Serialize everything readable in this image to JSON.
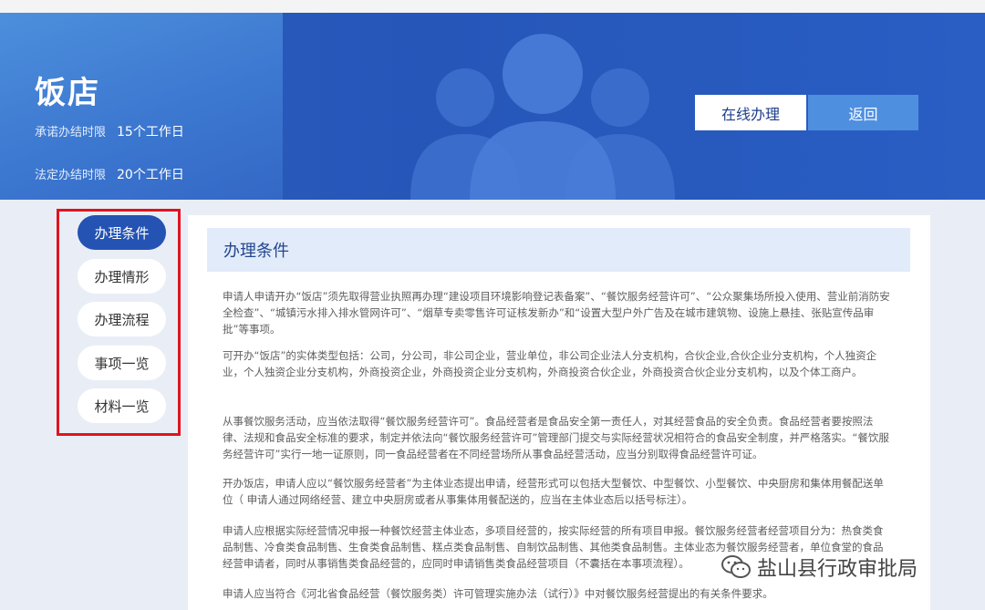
{
  "header": {
    "title": "饭店",
    "promise_label": "承诺办结时限",
    "promise_value": "15个工作日",
    "legal_label": "法定办结时限",
    "legal_value": "20个工作日",
    "online_button": "在线办理",
    "back_button": "返回"
  },
  "sidebar": {
    "items": [
      {
        "label": "办理条件",
        "active": true
      },
      {
        "label": "办理情形",
        "active": false
      },
      {
        "label": "办理流程",
        "active": false
      },
      {
        "label": "事项一览",
        "active": false
      },
      {
        "label": "材料一览",
        "active": false
      }
    ]
  },
  "content": {
    "heading": "办理条件",
    "paragraphs": [
      "申请人申请开办“饭店”须先取得营业执照再办理“建设项目环境影响登记表备案”、“餐饮服务经营许可”、“公众聚集场所投入使用、营业前消防安全检查”、“城镇污水排入排水管网许可”、“烟草专卖零售许可证核发新办”和“设置大型户外广告及在城市建筑物、设施上悬挂、张贴宣传品审批”等事项。",
      "可开办“饭店”的实体类型包括：公司，分公司，非公司企业，营业单位，非公司企业法人分支机构，合伙企业,合伙企业分支机构，个人独资企业，个人独资企业分支机构，外商投资企业，外商投资企业分支机构，外商投资合伙企业，外商投资合伙企业分支机构，以及个体工商户。",
      "从事餐饮服务活动，应当依法取得“餐饮服务经营许可”。食品经营者是食品安全第一责任人，对其经营食品的安全负责。食品经营者要按照法律、法规和食品安全标准的要求，制定并依法向“餐饮服务经营许可”管理部门提交与实际经营状况相符合的食品安全制度，并严格落实。“餐饮服务经营许可”实行一地一证原则，同一食品经营者在不同经营场所从事食品经营活动，应当分别取得食品经营许可证。",
      "开办饭店，申请人应以“餐饮服务经营者”为主体业态提出申请，经营形式可以包括大型餐饮、中型餐饮、小型餐饮、中央厨房和集体用餐配送单位（ 申请人通过网络经营、建立中央厨房或者从事集体用餐配送的，应当在主体业态后以括号标注）。",
      "申请人应根据实际经营情况申报一种餐饮经营主体业态，多项目经营的，按实际经营的所有项目申报。餐饮服务经营者经营项目分为：热食类食品制售、冷食类食品制售、生食类食品制售、糕点类食品制售、自制饮品制售、其他类食品制售。主体业态为餐饮服务经营者，单位食堂的食品经营申请者，同时从事销售类食品经营的，应同时申请销售类食品经营项目（不囊括在本事项流程）。",
      "申请人应当符合《河北省食品经营（餐饮服务类）许可管理实施办法（试行）》中对餐饮服务经营提出的有关条件要求。"
    ]
  },
  "watermark": {
    "text": "盐山县行政审批局"
  },
  "colors": {
    "banner": "#2656b8",
    "active_nav": "#2453b4",
    "highlight_border": "#e0141e",
    "header_bg": "#e2ebfa"
  }
}
